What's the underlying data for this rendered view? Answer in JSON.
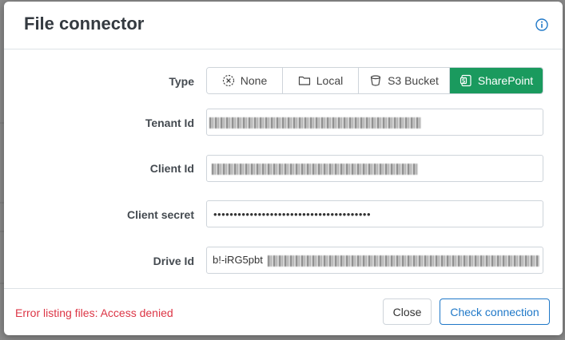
{
  "dialog": {
    "title": "File connector",
    "info_icon": "info-circle-icon"
  },
  "type": {
    "label": "Type",
    "options": [
      {
        "label": "None",
        "icon": "circle-x-icon"
      },
      {
        "label": "Local",
        "icon": "folder-icon"
      },
      {
        "label": "S3 Bucket",
        "icon": "bucket-icon"
      },
      {
        "label": "SharePoint",
        "icon": "sharepoint-icon"
      }
    ],
    "selected": "SharePoint"
  },
  "fields": {
    "tenant_id": {
      "label": "Tenant Id"
    },
    "client_id": {
      "label": "Client Id"
    },
    "client_secret": {
      "label": "Client secret",
      "value": "•••••••••••••••••••••••••••••••••••••••"
    },
    "drive_id": {
      "label": "Drive Id",
      "value": "b!-iRG5pbt"
    }
  },
  "footer": {
    "error": "Error listing files: Access denied",
    "close_label": "Close",
    "check_label": "Check connection"
  },
  "colors": {
    "active": "#1a9a5e",
    "error": "#dc3545",
    "primary": "#1f78c8"
  }
}
